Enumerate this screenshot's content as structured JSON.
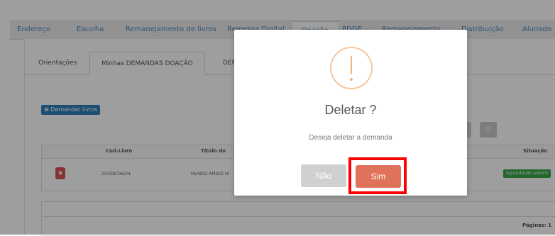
{
  "nav": {
    "items": [
      "Endereço",
      "Escolha",
      "Remanejamento de livros",
      "Remessa Digital",
      "Doação",
      "PDDE",
      "Remanejamento",
      "Distribuição",
      "Alunado"
    ]
  },
  "subtabs": [
    "Orientações",
    "Minhas DEMANDAS DOAÇÃO",
    "DEMANDAS"
  ],
  "toolbar": {
    "demandar_label": "⊞ Demandar livros"
  },
  "table": {
    "headers": {
      "cod": "Cod.Livro",
      "titulo": "Título do",
      "situacao": "Situação"
    },
    "row": {
      "cod": "25358C0620L",
      "titulo": "MUNDO AMIGO HI",
      "status": "Aguardando autoriz",
      "status_color": "#3aa64a"
    }
  },
  "footer": {
    "paginas": "Páginas:  1"
  },
  "modal": {
    "title": "Deletar ?",
    "text": "Deseja deletar a demanda",
    "cancel_label": "Não",
    "confirm_label": "Sim",
    "confirm_color": "#e0725c",
    "warning_color": "#f6c89a"
  },
  "icons": {
    "warning": "exclamation-circle-icon",
    "delete": "x-icon",
    "settings": "gear-icon"
  }
}
